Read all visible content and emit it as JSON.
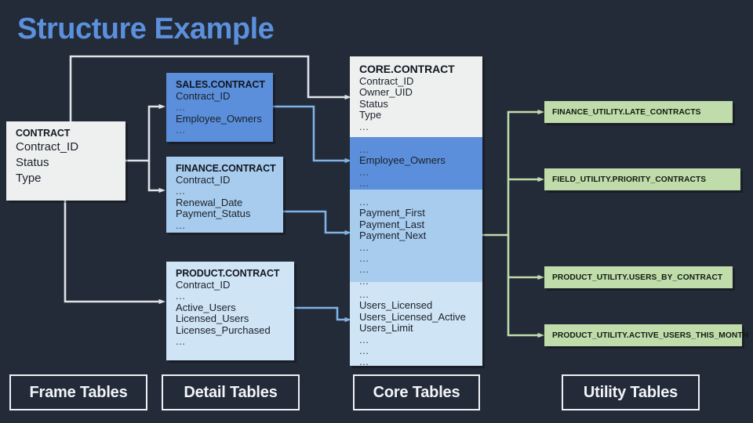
{
  "title": "Structure Example",
  "colors": {
    "background": "#232a38",
    "title": "#5b90dd",
    "frame_table": "#eef0f0",
    "sales_blue": "#5b8fdb",
    "finance_blue": "#a8ccee",
    "product_blue": "#cfe4f5",
    "core_white": "#eef0f0",
    "utility_green": "#bfdcaa",
    "wire_white": "#dfe3e8",
    "wire_blue": "#7fb3e6",
    "wire_green": "#bfdcaa"
  },
  "frame_tables": [
    {
      "name": "CONTRACT",
      "fields": [
        "Contract_ID",
        "Status",
        "Type"
      ]
    }
  ],
  "detail_tables": [
    {
      "name": "SALES.CONTRACT",
      "fields": [
        "Contract_ID",
        "...",
        "Employee_Owners",
        "..."
      ]
    },
    {
      "name": "FINANCE.CONTRACT",
      "fields": [
        "Contract_ID",
        "...",
        "Renewal_Date",
        "Payment_Status",
        "..."
      ]
    },
    {
      "name": "PRODUCT.CONTRACT",
      "fields": [
        "Contract_ID",
        "...",
        "Active_Users",
        "Licensed_Users",
        "Licenses_Purchased",
        "..."
      ]
    }
  ],
  "core_table": {
    "name": "CORE.CONTRACT",
    "bands": [
      {
        "source": "frame",
        "fields": [
          "Contract_ID",
          "Owner_UID",
          "Status",
          "Type",
          "..."
        ]
      },
      {
        "source": "sales",
        "fields": [
          "...",
          "Employee_Owners",
          "...",
          "..."
        ]
      },
      {
        "source": "finance",
        "fields": [
          "...",
          "Payment_First",
          "Payment_Last",
          "Payment_Next",
          "...",
          "...",
          "...",
          "..."
        ]
      },
      {
        "source": "product",
        "fields": [
          "...",
          "Users_Licensed",
          "Users_Licensed_Active",
          "Users_Limit",
          "...",
          "...",
          "..."
        ]
      }
    ]
  },
  "utility_tables": [
    {
      "label": "FINANCE_UTILITY.LATE_CONTRACTS"
    },
    {
      "label": "FIELD_UTILITY.PRIORITY_CONTRACTS"
    },
    {
      "label": "PRODUCT_UTILITY.USERS_BY_CONTRACT"
    },
    {
      "label": "PRODUCT_UTILITY.ACTIVE_USERS_THIS_MONTH"
    }
  ],
  "legend": [
    {
      "label": "Frame Tables"
    },
    {
      "label": "Detail Tables"
    },
    {
      "label": "Core Tables"
    },
    {
      "label": "Utility Tables"
    }
  ]
}
